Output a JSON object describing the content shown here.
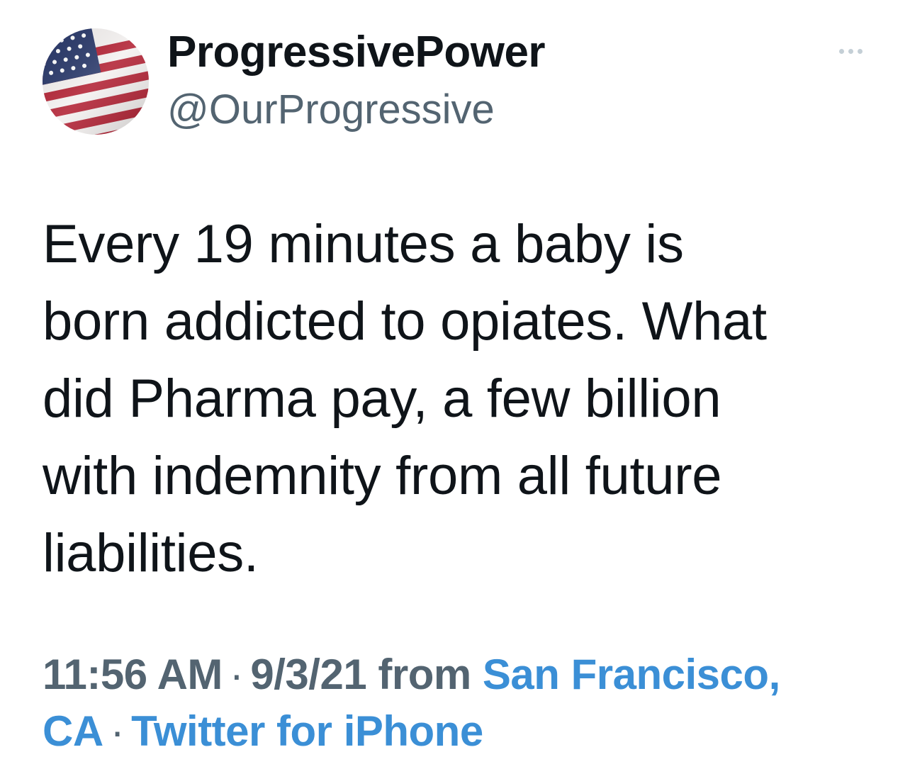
{
  "author": {
    "display_name": "ProgressivePower",
    "handle": "@OurProgressive",
    "avatar_icon": "american-flag-avatar"
  },
  "tweet": {
    "text": "Every 19 minutes a baby is\nborn addicted to opiates. What\ndid Pharma pay, a few billion\nwith indemnity from all future\nliabilities."
  },
  "meta": {
    "time": "11:56 AM",
    "separator": "·",
    "date": "9/3/21",
    "from_label": "from",
    "location": "San Francisco, CA",
    "source": "Twitter for iPhone"
  },
  "icons": {
    "more": "more-options-icon"
  },
  "colors": {
    "text_primary": "#0f1419",
    "text_secondary": "#536471",
    "link": "#3b8fd6",
    "more_dots": "#c4cfd6"
  }
}
